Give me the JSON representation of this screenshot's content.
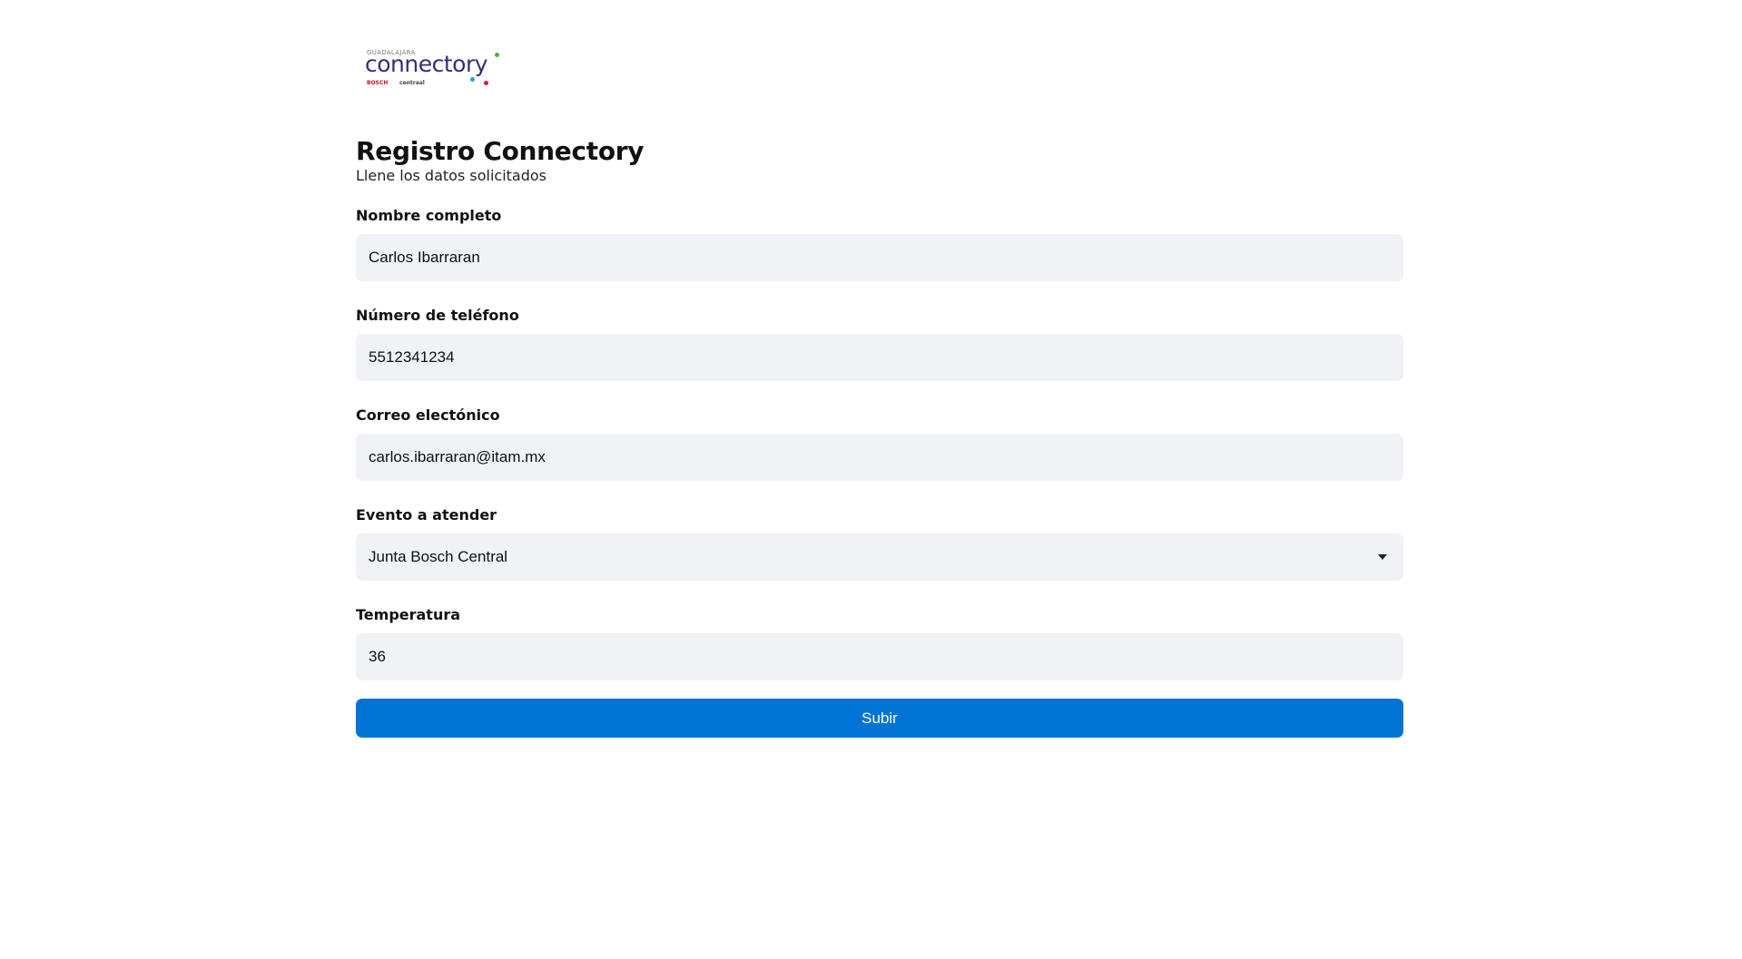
{
  "logo": {
    "top_text": "GUADALAJARA",
    "word": "connectory",
    "sub_left": "BOSCH",
    "sub_right": "centraal"
  },
  "header": {
    "title": "Registro Connectory",
    "subtitle": "Llene los datos solicitados"
  },
  "form": {
    "fields": [
      {
        "label": "Nombre completo",
        "value": "Carlos Ibarraran"
      },
      {
        "label": "Número de teléfono",
        "value": "5512341234"
      },
      {
        "label": "Correo electónico",
        "value": "carlos.ibarraran@itam.mx"
      },
      {
        "label": "Evento a atender",
        "value": "Junta Bosch Central"
      },
      {
        "label": "Temperatura",
        "value": "36"
      }
    ],
    "submit_label": "Subir"
  },
  "colors": {
    "button": "#0274d6",
    "input_background": "#f1f2f5",
    "logo_purple": "#3b2a7a"
  },
  "icons": {
    "select_caret": "chevron-down-icon"
  }
}
